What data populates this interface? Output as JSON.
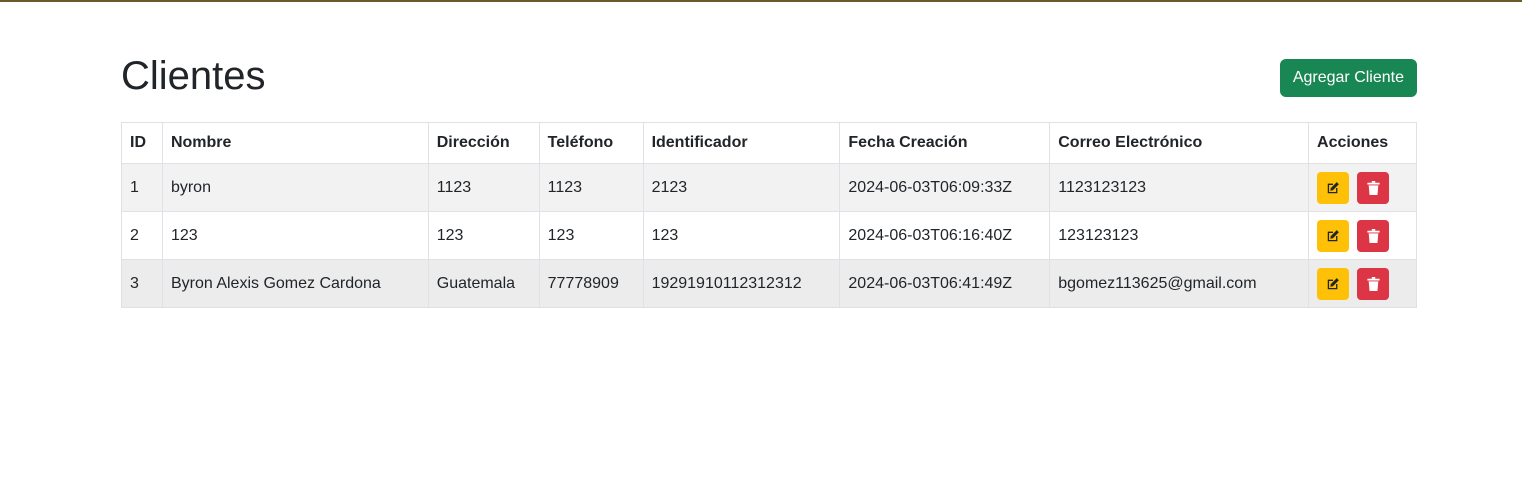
{
  "page": {
    "title": "Clientes",
    "add_button_label": "Agregar Cliente"
  },
  "colors": {
    "add_button": "#198754",
    "edit_button": "#ffc107",
    "delete_button": "#dc3545"
  },
  "table": {
    "headers": [
      "ID",
      "Nombre",
      "Dirección",
      "Teléfono",
      "Identificador",
      "Fecha Creación",
      "Correo Electrónico",
      "Acciones"
    ],
    "rows": [
      {
        "id": "1",
        "nombre": "byron",
        "direccion": "1123",
        "telefono": "1123",
        "identificador": "2123",
        "fecha_creacion": "2024-06-03T06:09:33Z",
        "correo": "1123123123",
        "actions": [
          "edit-icon",
          "trash-icon"
        ]
      },
      {
        "id": "2",
        "nombre": "123",
        "direccion": "123",
        "telefono": "123",
        "identificador": "123",
        "fecha_creacion": "2024-06-03T06:16:40Z",
        "correo": "123123123",
        "actions": [
          "edit-icon",
          "trash-icon"
        ]
      },
      {
        "id": "3",
        "nombre": "Byron Alexis Gomez Cardona",
        "direccion": "Guatemala",
        "telefono": "77778909",
        "identificador": "19291910112312312",
        "fecha_creacion": "2024-06-03T06:41:49Z",
        "correo": "bgomez113625@gmail.com",
        "actions": [
          "edit-icon",
          "trash-icon"
        ]
      }
    ]
  }
}
